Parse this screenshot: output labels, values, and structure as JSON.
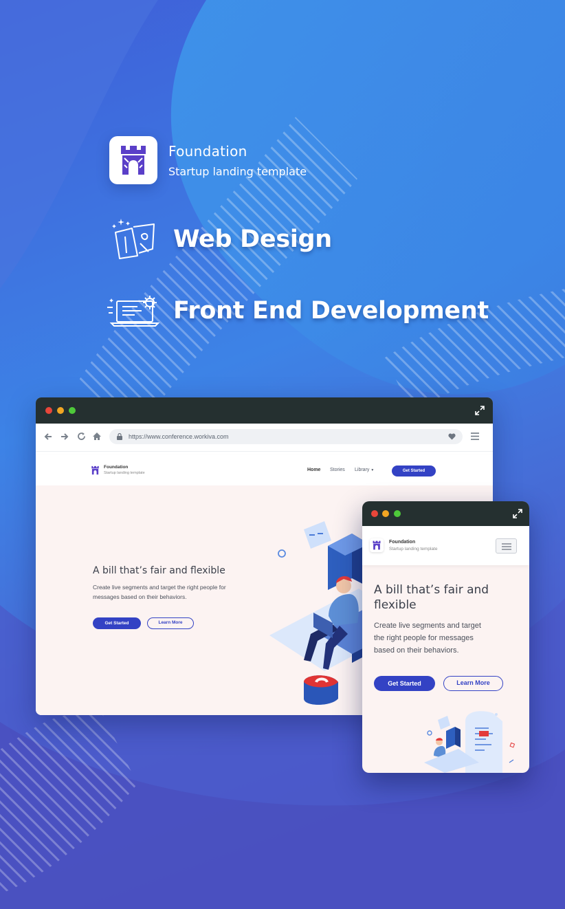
{
  "brand": {
    "name": "Foundation",
    "tagline": "Startup landing template"
  },
  "features": [
    {
      "label": "Web Design",
      "icon": "design-tools-icon"
    },
    {
      "label": "Front End Development",
      "icon": "laptop-gear-icon"
    }
  ],
  "desktop": {
    "url": "https://www.conference.workiva.com",
    "site": {
      "brand_name": "Foundation",
      "brand_tag": "Startup landing template",
      "nav": {
        "home": "Home",
        "stories": "Stories",
        "library": "Library",
        "cta": "Get Started"
      },
      "hero": {
        "title": "A bill that’s fair and flexible",
        "text_line1": "Create live segments and target the right people for",
        "text_line2": "messages based on their behaviors.",
        "primary_button": "Get Started",
        "secondary_button": "Learn More"
      }
    }
  },
  "mobile": {
    "site": {
      "brand_name": "Foundation",
      "brand_tag": "Startup landing template",
      "hero": {
        "title_line1": "A bill that’s fair and",
        "title_line2": "flexible",
        "text_line1": "Create live segments and target",
        "text_line2": "the right people for messages",
        "text_line3": "based on their behaviors.",
        "primary_button": "Get Started",
        "secondary_button": "Learn More"
      }
    }
  },
  "colors": {
    "accent": "#3342c4",
    "brand_purple": "#5a3fc8",
    "titlebar": "#253030",
    "hero_bg": "#fcf3f2",
    "dot_red": "#e8463a",
    "dot_yellow": "#f2a623",
    "dot_green": "#4ec93a"
  }
}
